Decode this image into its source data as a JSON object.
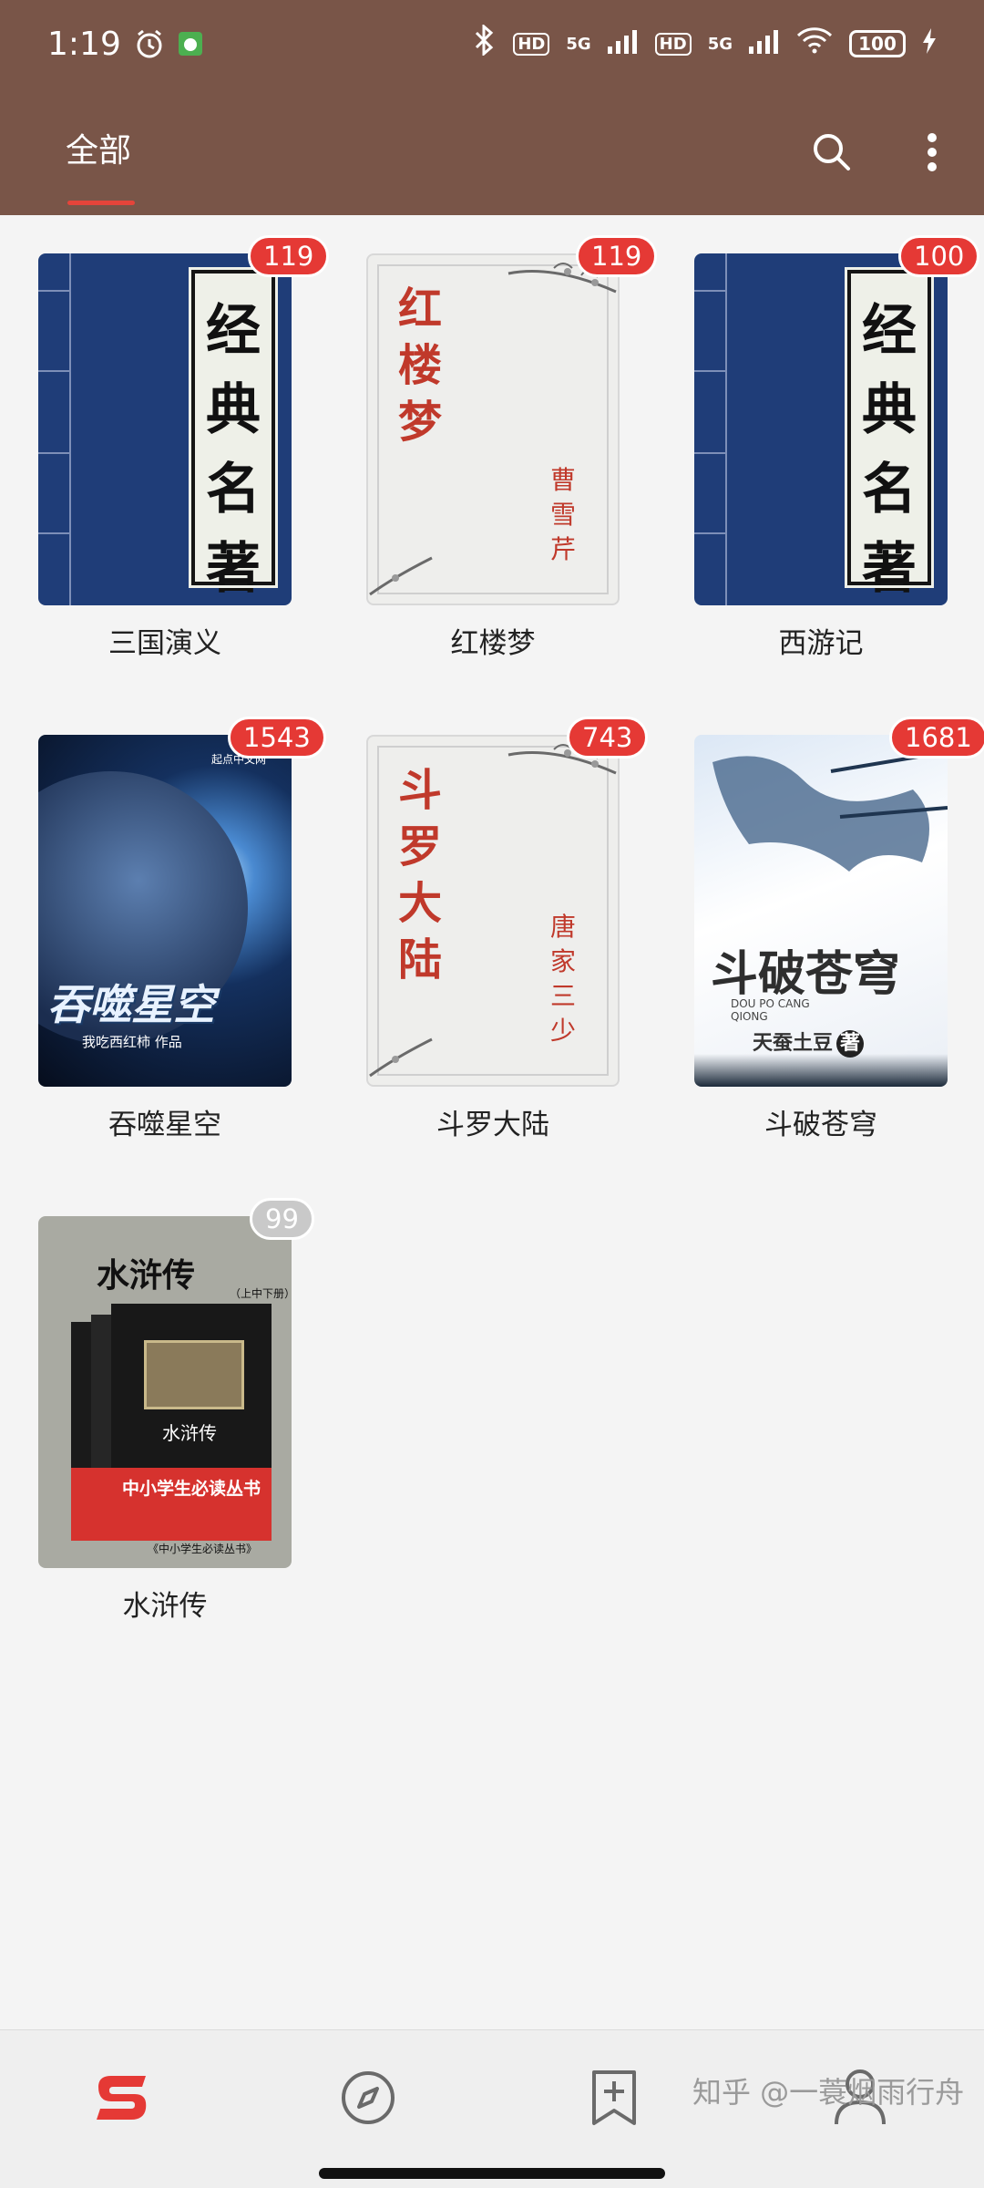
{
  "status": {
    "time": "1:19",
    "hd1": "HD",
    "net1": "5G",
    "hd2": "HD",
    "net2": "5G",
    "battery": "100"
  },
  "header": {
    "tab_all": "全部"
  },
  "books": [
    {
      "title": "三国演义",
      "count": "119",
      "cover_text": [
        "经",
        "典",
        "名",
        "著"
      ]
    },
    {
      "title": "红楼梦",
      "count": "119",
      "cover_title": [
        "红",
        "楼",
        "梦"
      ],
      "cover_author": [
        "曹",
        "雪",
        "芹"
      ]
    },
    {
      "title": "西游记",
      "count": "100",
      "cover_text": [
        "经",
        "典",
        "名",
        "著"
      ]
    },
    {
      "title": "吞噬星空",
      "count": "1543",
      "cover_title": "吞噬星空",
      "cover_publisher": "起点中文网",
      "cover_author": "我吃西红柿 作品"
    },
    {
      "title": "斗罗大陆",
      "count": "743",
      "cover_title": [
        "斗",
        "罗",
        "大",
        "陆"
      ],
      "cover_author": [
        "唐",
        "家",
        "三",
        "少"
      ]
    },
    {
      "title": "斗破苍穹",
      "count": "1681",
      "cover_title": "斗破苍穹",
      "cover_pinyin": "DOU PO CANG QIONG",
      "cover_author": "天蚕土豆",
      "cover_author_suffix": "著"
    },
    {
      "title": "水浒传",
      "count": "99",
      "cover_title": "水浒传",
      "cover_sub": "（上中下册）",
      "cover_banner": "中小学生必读丛书",
      "cover_footer": "《中小学生必读丛书》",
      "box_title": "水浒传"
    }
  ],
  "watermark": "知乎 @一蓑烟雨行舟",
  "colors": {
    "header": "#795548",
    "accent": "#e53935",
    "badge_muted": "#c9c9c9"
  },
  "icons": {
    "status_left": [
      "alarm-icon",
      "wechat-icon"
    ],
    "status_right": [
      "bluetooth-icon",
      "signal-icon",
      "wifi-icon",
      "battery-icon",
      "charging-icon"
    ],
    "toolbar": [
      "search-icon",
      "more-vertical-icon"
    ],
    "nav": [
      "bookshelf-icon",
      "compass-icon",
      "bookmark-add-icon",
      "profile-icon"
    ]
  }
}
